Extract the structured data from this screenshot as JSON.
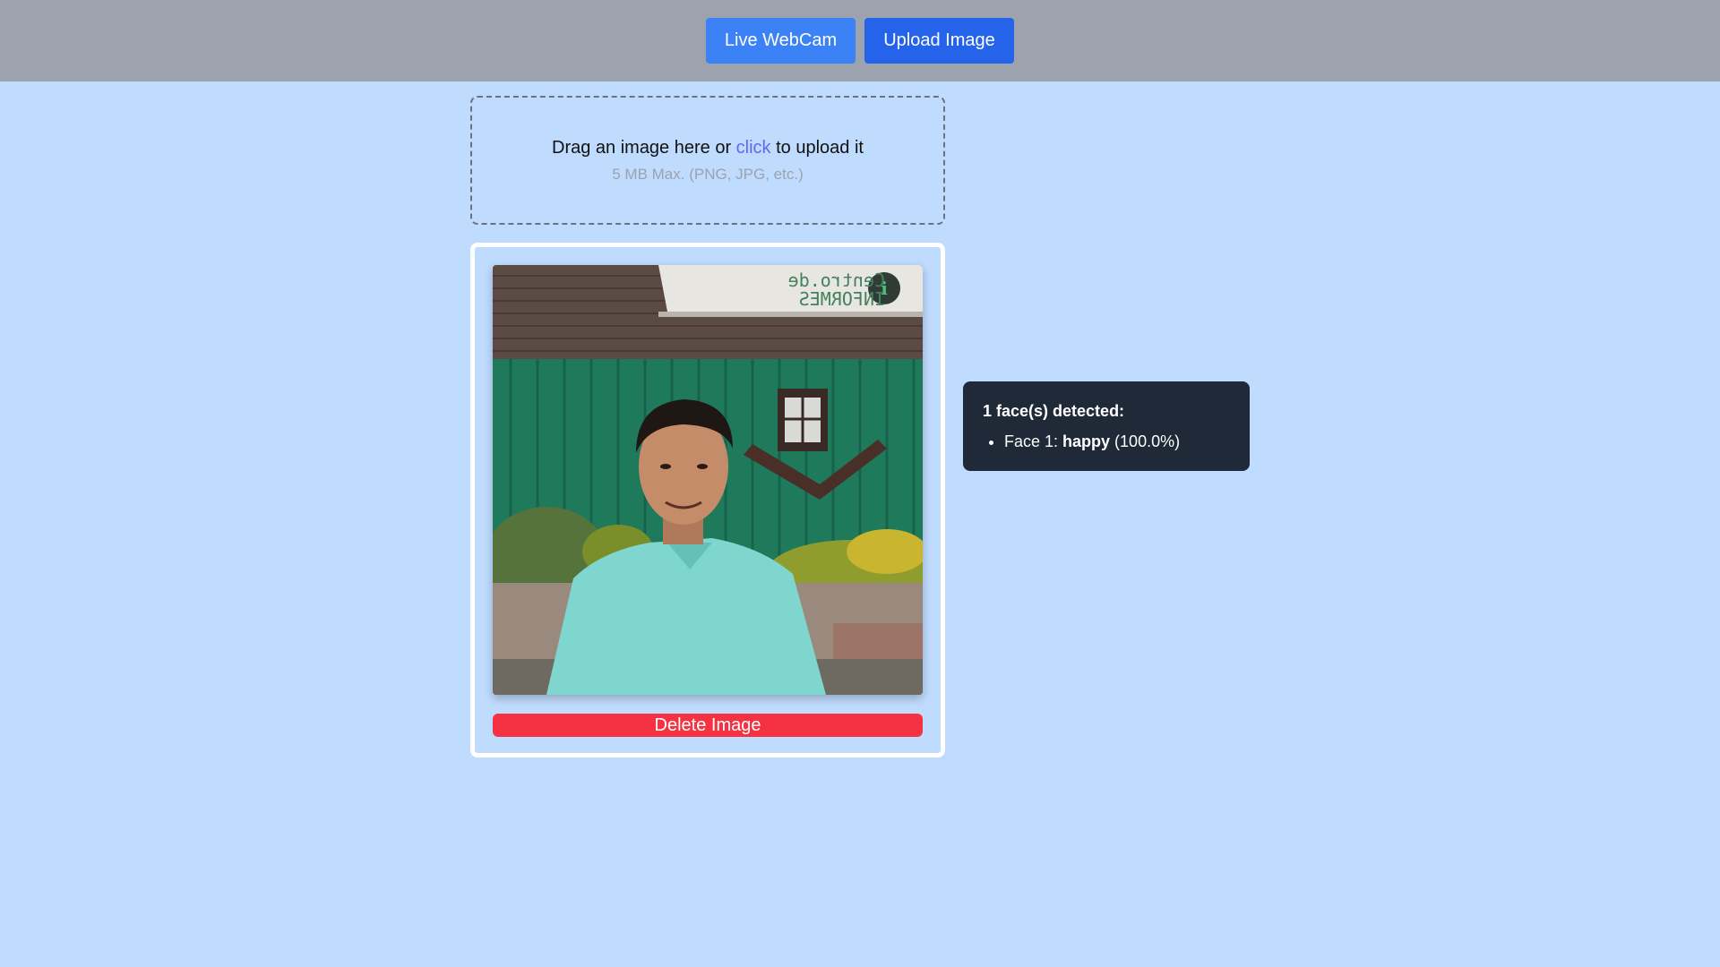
{
  "header": {
    "webcam_label": "Live WebCam",
    "upload_label": "Upload Image"
  },
  "dropzone": {
    "text_before": "Drag an image here or ",
    "link_text": "click",
    "text_after": " to upload it",
    "hint": "5 MB Max. (PNG, JPG, etc.)"
  },
  "image_card": {
    "delete_label": "Delete Image",
    "photo_sign_line1": "Centro.de",
    "photo_sign_line2": "INFORMES",
    "photo_sign_logo": "i"
  },
  "results": {
    "title": "1 face(s) detected:",
    "faces": [
      {
        "prefix": "Face 1: ",
        "emotion": "happy",
        "confidence": " (100.0%)"
      }
    ]
  },
  "colors": {
    "page_background": "#bfdbfe",
    "header_background": "#9ca3af",
    "webcam_button": "#3b82f6",
    "upload_button": "#2563eb",
    "delete_button": "#f53241",
    "results_background": "#1f2937",
    "link": "#6366f1"
  }
}
